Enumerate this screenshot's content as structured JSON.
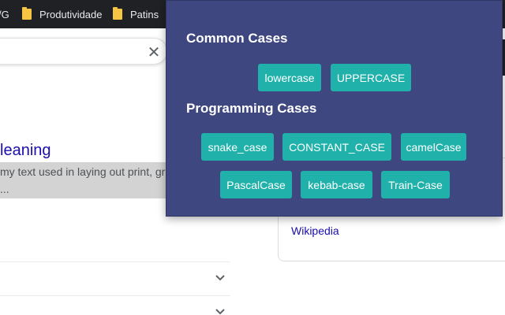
{
  "bookmarks": {
    "partial_label": "/G",
    "items": [
      {
        "label": "Produtividade",
        "icon": "folder-icon"
      },
      {
        "label": "Patins",
        "icon": "folder-icon"
      }
    ]
  },
  "search": {
    "clear_icon": "close-icon",
    "clear_glyph": "✕"
  },
  "result": {
    "title": "leaning",
    "snippet": "my text used in laying out print, gra",
    "snippet_more": "..."
  },
  "accordion": {
    "chevron_icon": "chevron-down-icon"
  },
  "knowledge_panel": {
    "link": "Wikipedia"
  },
  "popup": {
    "background": "#3e4780",
    "button_color": "#20b2aa",
    "sections": [
      {
        "heading": "Common Cases",
        "buttons": [
          "lowercase",
          "UPPERCASE"
        ]
      },
      {
        "heading": "Programming Cases",
        "buttons": [
          "snake_case",
          "CONSTANT_CASE",
          "camelCase",
          "PascalCase",
          "kebab-case",
          "Train-Case"
        ]
      }
    ]
  }
}
